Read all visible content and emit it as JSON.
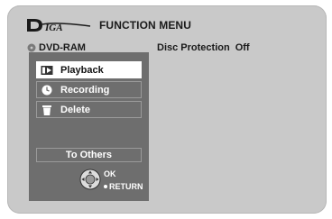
{
  "header": {
    "brand": "DIGA",
    "menu_title": "FUNCTION MENU"
  },
  "disc": {
    "type": "DVD-RAM",
    "protection_label": "Disc Protection",
    "protection_value": "Off"
  },
  "menu": {
    "items": [
      {
        "label": "Playback",
        "icon": "playback-icon",
        "selected": true
      },
      {
        "label": "Recording",
        "icon": "clock-icon",
        "selected": false
      },
      {
        "label": "Delete",
        "icon": "trash-icon",
        "selected": false
      }
    ],
    "to_others": "To Others"
  },
  "nav": {
    "ok": "OK",
    "return": "RETURN"
  }
}
